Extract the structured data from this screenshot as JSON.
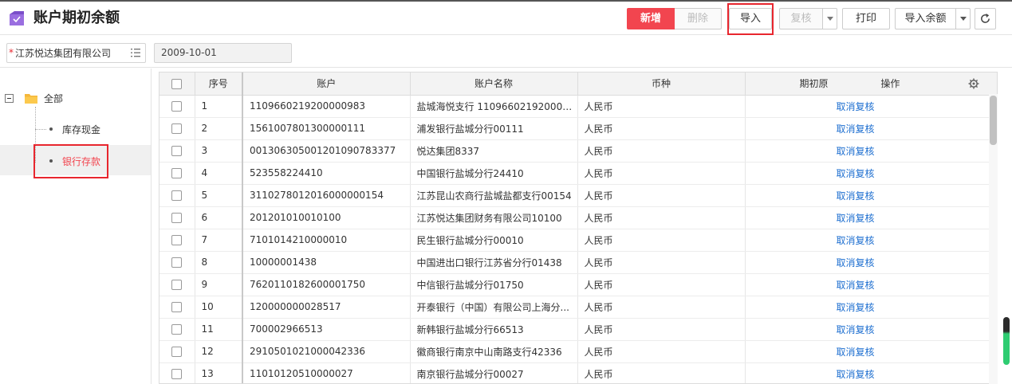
{
  "header": {
    "title": "账户期初余额",
    "buttons": {
      "add": "新增",
      "delete": "删除",
      "import": "导入",
      "review": "复核",
      "print": "打印",
      "import_balance": "导入余额"
    }
  },
  "filters": {
    "company": "江苏悦达集团有限公司",
    "date": "2009-10-01"
  },
  "tree": {
    "root": "全部",
    "items": [
      "库存现金",
      "银行存款"
    ],
    "selected": "银行存款"
  },
  "table": {
    "headers": {
      "seq": "序号",
      "account": "账户",
      "account_name": "账户名称",
      "currency": "币种",
      "opening": "期初原",
      "operation": "操作"
    },
    "rows": [
      {
        "seq": "1",
        "account": "1109660219200000983",
        "name": "盐城海悦支行 1109660219200000...",
        "currency": "人民币",
        "op": "取消复核"
      },
      {
        "seq": "2",
        "account": "1561007801300000111",
        "name": "浦发银行盐城分行00111",
        "currency": "人民币",
        "op": "取消复核"
      },
      {
        "seq": "3",
        "account": "001306305001201090783377",
        "name": "悦达集团8337",
        "currency": "人民币",
        "op": "取消复核"
      },
      {
        "seq": "4",
        "account": "523558224410",
        "name": "中国银行盐城分行24410",
        "currency": "人民币",
        "op": "取消复核"
      },
      {
        "seq": "5",
        "account": "3110278012016000000154",
        "name": "江苏昆山农商行盐城盐都支行00154",
        "currency": "人民币",
        "op": "取消复核"
      },
      {
        "seq": "6",
        "account": "201201010010100",
        "name": "江苏悦达集团财务有限公司10100",
        "currency": "人民币",
        "op": "取消复核"
      },
      {
        "seq": "7",
        "account": "7101014210000010",
        "name": "民生银行盐城分行00010",
        "currency": "人民币",
        "op": "取消复核"
      },
      {
        "seq": "8",
        "account": "10000001438",
        "name": "中国进出口银行江苏省分行01438",
        "currency": "人民币",
        "op": "取消复核"
      },
      {
        "seq": "9",
        "account": "7620110182600001750",
        "name": "中信银行盐城分行01750",
        "currency": "人民币",
        "op": "取消复核"
      },
      {
        "seq": "10",
        "account": "120000000028517",
        "name": "开泰银行（中国）有限公司上海分...",
        "currency": "人民币",
        "op": "取消复核"
      },
      {
        "seq": "11",
        "account": "700002966513",
        "name": "新韩银行盐城分行66513",
        "currency": "人民币",
        "op": "取消复核"
      },
      {
        "seq": "12",
        "account": "2910501021000042336",
        "name": "徽商银行南京中山南路支行42336",
        "currency": "人民币",
        "op": "取消复核"
      },
      {
        "seq": "13",
        "account": "11010120510000027",
        "name": "南京银行盐城分行00027",
        "currency": "人民币",
        "op": "取消复核"
      }
    ]
  },
  "icons": {
    "app": "app-icon",
    "refresh": "refresh-icon",
    "list": "list-icon",
    "folder": "folder-icon",
    "settings": "gear-icon"
  },
  "colors": {
    "primary": "#f2454f",
    "highlight": "#e8262e",
    "link": "#1e6fd0",
    "app_icon": "#7b4fc9"
  }
}
